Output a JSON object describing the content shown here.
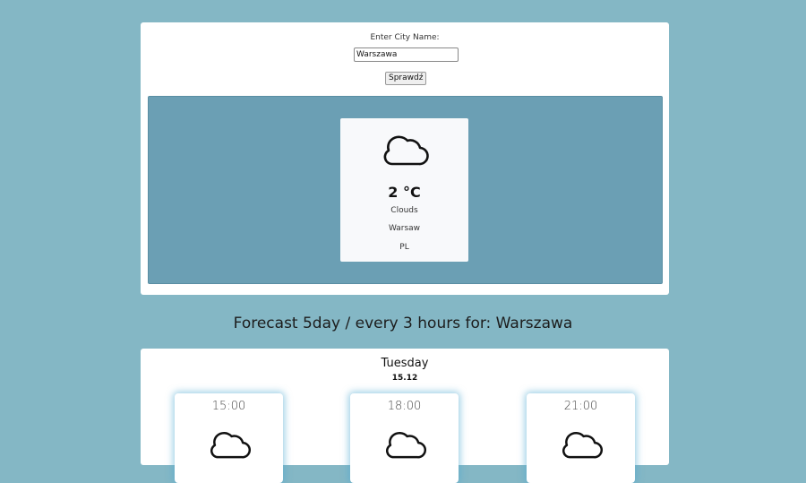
{
  "search": {
    "label": "Enter City Name:",
    "value": "Warszawa",
    "button_label": "Sprawdź"
  },
  "current": {
    "icon": "cloud-icon",
    "temperature": "2 °C",
    "description": "Clouds",
    "city": "Warsaw",
    "country": "PL"
  },
  "forecast": {
    "title": "Forecast 5day / every 3 hours for: Warszawa",
    "day": "Tuesday",
    "date": "15.12",
    "hours": [
      {
        "time": "15:00",
        "icon": "cloud-icon"
      },
      {
        "time": "18:00",
        "icon": "cloud-icon"
      },
      {
        "time": "21:00",
        "icon": "cloud-icon"
      }
    ]
  }
}
